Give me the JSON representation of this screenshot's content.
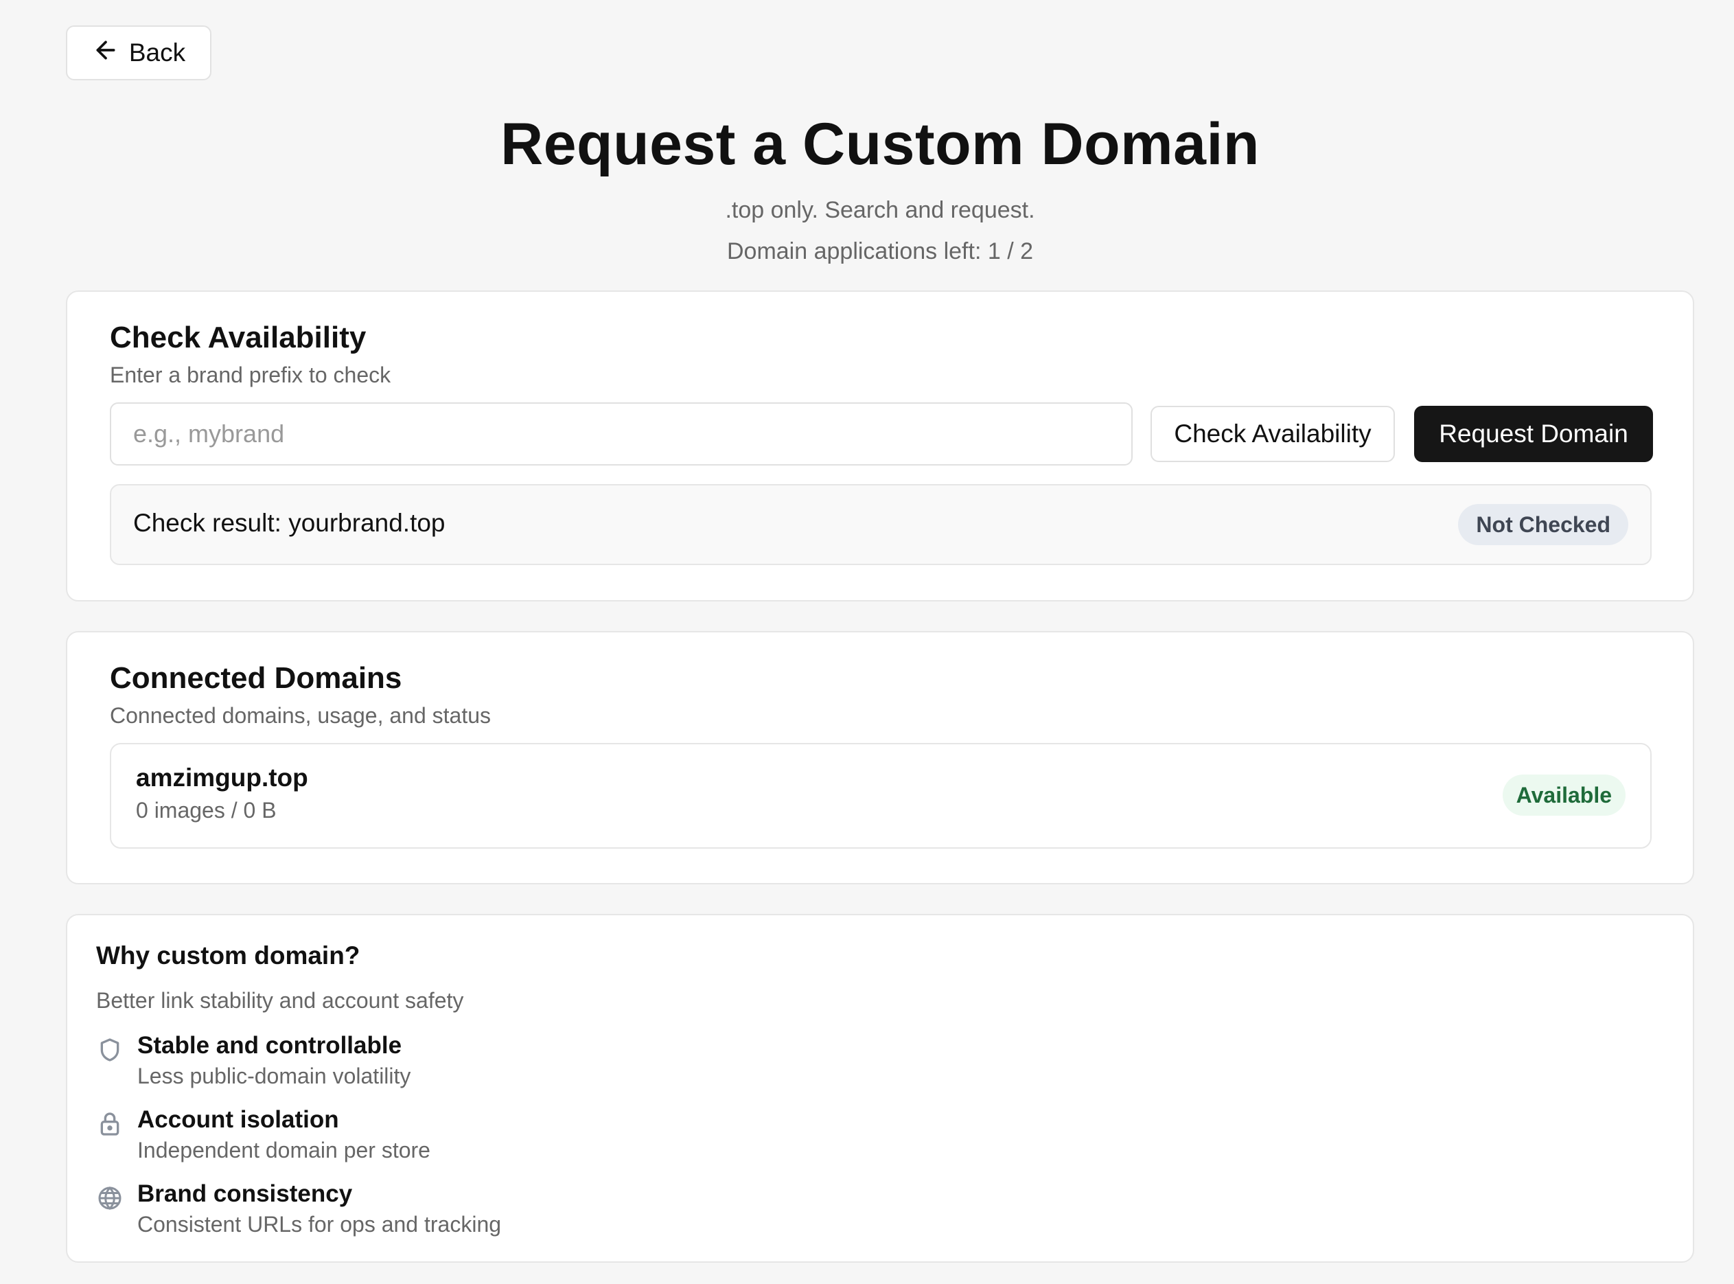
{
  "nav": {
    "back_label": "Back",
    "back_icon": "arrow-left-icon"
  },
  "header": {
    "title": "Request a Custom Domain",
    "subtitle": ".top only. Search and request.",
    "quota": "Domain applications left: 1 / 2"
  },
  "check_availability": {
    "title": "Check Availability",
    "description": "Enter a brand prefix to check",
    "input": {
      "value": "",
      "placeholder": "e.g., mybrand"
    },
    "check_button_label": "Check Availability",
    "request_button_label": "Request Domain",
    "result": {
      "text": "Check result: yourbrand.top",
      "status": "Not Checked"
    }
  },
  "connected_domains": {
    "title": "Connected Domains",
    "description": "Connected domains, usage, and status",
    "items": [
      {
        "domain": "amzimgup.top",
        "usage": "0 images / 0 B",
        "status": "Available"
      }
    ]
  },
  "why": {
    "title": "Why custom domain?",
    "description": "Better link stability and account safety",
    "features": [
      {
        "icon": "shield-icon",
        "title": "Stable and controllable",
        "description": "Less public-domain volatility"
      },
      {
        "icon": "lock-icon",
        "title": "Account isolation",
        "description": "Independent domain per store"
      },
      {
        "icon": "globe-icon",
        "title": "Brand consistency",
        "description": "Consistent URLs for ops and tracking"
      }
    ]
  },
  "colors": {
    "primary_button": "#161616",
    "badge_neutral_bg": "#e7ebf1",
    "badge_success_bg": "#ecf9f0",
    "badge_success_text": "#1f6b3a"
  }
}
